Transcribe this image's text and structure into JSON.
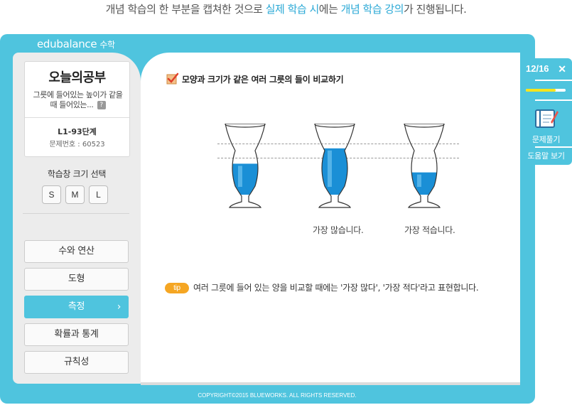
{
  "caption": {
    "part1": "개념 학습의 한 부분을 캡쳐한 것으로 ",
    "highlight1": "실제 학습 시",
    "part2": "에는 ",
    "highlight2": "개념 학습 강의",
    "part3": "가 진행됩니다."
  },
  "brand": {
    "name": "edubalance",
    "sub": "수학"
  },
  "lesson": {
    "title": "오늘의공부",
    "description": "그릇에 들어있는 높이가 같을 때 들어있는...",
    "help": "?",
    "level": "L1-93단계",
    "number": "문제번호 : 60523"
  },
  "size_select": {
    "label": "학습창 크기 선택",
    "options": [
      "S",
      "M",
      "L"
    ]
  },
  "menu": [
    {
      "label": "수와 연산",
      "active": false
    },
    {
      "label": "도형",
      "active": false
    },
    {
      "label": "측정",
      "active": true
    },
    {
      "label": "확률과 통계",
      "active": false
    },
    {
      "label": "규칙성",
      "active": false
    }
  ],
  "content": {
    "title": "모양과 크기가 같은 여러 그릇의 들이 비교하기",
    "glass_labels": [
      "가장 많습니다.",
      "가장 적습니다."
    ],
    "tip_badge": "tip",
    "tip_text": "여러 그릇에 들어 있는 양을 비교할 때에는 '가장 많다', '가장 적다'라고 표현합니다.",
    "glass_fill_levels": [
      0.55,
      0.85,
      0.38
    ]
  },
  "footer": {
    "copyright": "COPYRIGHT©2015 BLUEWORKS. ALL RIGHTS RESERVED."
  },
  "right_panel": {
    "progress": "12/16",
    "close": "✕",
    "progress_fraction": 0.75,
    "solve_label": "문제풀기",
    "help_label": "도움말 보기"
  },
  "colors": {
    "accent": "#4fc4de",
    "water": "#1a8fd6",
    "tip": "#f5a623",
    "progress_fill": "#f7e41d"
  }
}
